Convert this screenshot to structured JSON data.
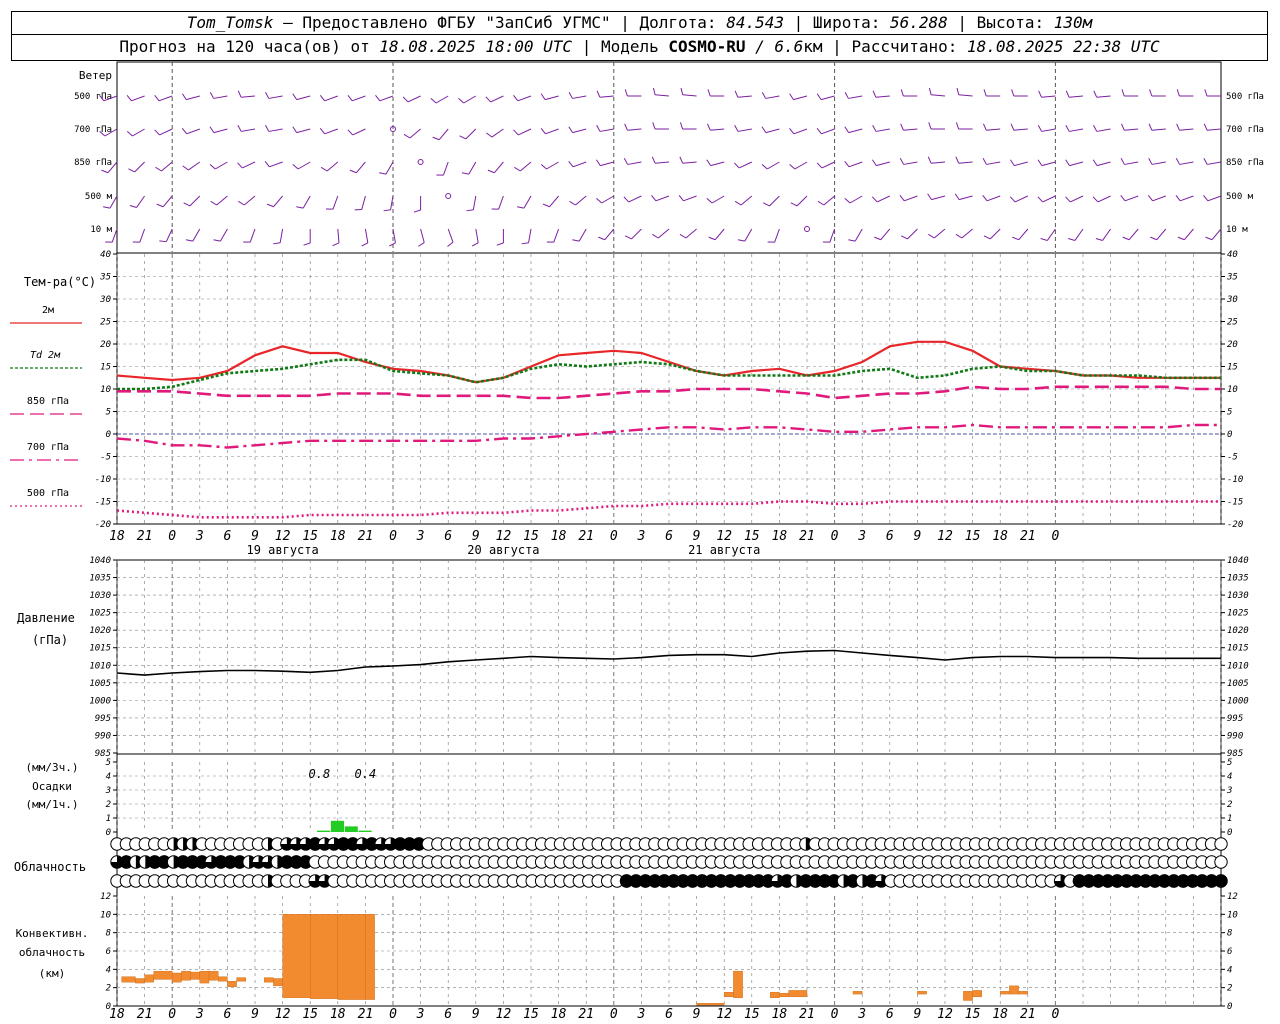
{
  "header": {
    "station": "Tom_Tomsk",
    "dash": " – ",
    "provider": "Предоставлено ФГБУ \"ЗапСиб УГМС\"",
    "sep": " | ",
    "lon_label": "Долгота: ",
    "lon_value": "84.543",
    "lat_label": "Широта: ",
    "lat_value": "56.288",
    "alt_label": "Высота: ",
    "alt_value": "130м",
    "forecast_prefix": "Прогноз на 120 часа(ов) от ",
    "forecast_start": "18.08.2025 18:00 UTC",
    "model_label": "Модель ",
    "model_name": "COSMO-RU",
    "model_res": " / 6.6",
    "model_unit": "км",
    "calc_label": "Рассчитано: ",
    "calc_time": "18.08.2025 22:38 UTC"
  },
  "labels": {
    "wind_title": "Ветер",
    "wind_levels": [
      "500 гПа",
      "700 гПа",
      "850 гПа",
      "500 м",
      "10  м"
    ],
    "temp_title": "Тем-ра(°C)",
    "temp_legend": [
      "2м",
      "Td  2м",
      "850 гПа",
      "700 гПа",
      "500 гПа"
    ],
    "pressure_title": [
      "Давление",
      "(гПа)"
    ],
    "precip_title": [
      "(мм/3ч.)",
      "Осадки",
      "(мм/1ч.)"
    ],
    "cloud_title": "Облачность",
    "conv_title": [
      "Конвективн.",
      "облачность",
      "(км)"
    ],
    "dates": [
      "19 августа",
      "20 августа",
      "21 августа"
    ],
    "hour_ticks": [
      "18",
      "21",
      "0",
      "3",
      "6",
      "9",
      "12",
      "15",
      "18",
      "21",
      "0",
      "3",
      "6",
      "9",
      "12",
      "15",
      "18",
      "21",
      "0",
      "3",
      "6",
      "9",
      "12",
      "15",
      "18",
      "21",
      "0",
      "3",
      "6",
      "9",
      "12",
      "15",
      "18",
      "21",
      "0"
    ]
  },
  "colors": {
    "wind": "#7b1fa2",
    "t2m": "#e8262a",
    "td2m": "#117a17",
    "t850": "#e0197d",
    "t700": "#e0197d",
    "t500": "#e0197d",
    "pressure": "#000000",
    "precip": "#22cc22",
    "convective": "#f28a30",
    "zero_line": "#2a2aa0"
  },
  "chart_data": {
    "type": "line",
    "x_unit": "hours since 18.08.2025 18:00 UTC",
    "x": [
      0,
      3,
      6,
      9,
      12,
      15,
      18,
      21,
      24,
      27,
      30,
      33,
      36,
      39,
      42,
      45,
      48,
      51,
      54,
      57,
      60,
      63,
      66,
      69,
      72,
      75,
      78,
      81,
      84,
      87,
      90,
      93,
      96,
      99,
      102,
      105,
      108,
      111,
      114,
      117,
      120
    ],
    "temperature": {
      "ylim": [
        -20,
        40
      ],
      "series": [
        {
          "name": "2м",
          "values": [
            13,
            12.5,
            12,
            12.5,
            14,
            17.5,
            19.5,
            18,
            18,
            16,
            14.5,
            14,
            13,
            11.5,
            12.5,
            15,
            17.5,
            18,
            18.5,
            18,
            16,
            14,
            13,
            14,
            14.5,
            13,
            14,
            16,
            19.5,
            20.5,
            20.5,
            18.5,
            15,
            14.5,
            14,
            13,
            13,
            12.5,
            12.5,
            12.5,
            12.5
          ]
        },
        {
          "name": "Td  2м",
          "values": [
            10,
            10,
            10.5,
            12,
            13.5,
            14,
            14.5,
            15.5,
            16.5,
            16.5,
            14,
            13.5,
            13,
            11.5,
            12.5,
            14.5,
            15.5,
            15,
            15.5,
            16,
            15.5,
            14,
            13,
            13,
            13,
            13,
            13,
            14,
            14.5,
            12.5,
            13,
            14.5,
            15,
            14,
            14,
            13,
            13,
            13,
            12.5,
            12.5,
            12.5
          ]
        },
        {
          "name": "850 гПа",
          "values": [
            9.5,
            9.5,
            9.5,
            9,
            8.5,
            8.5,
            8.5,
            8.5,
            9,
            9,
            9,
            8.5,
            8.5,
            8.5,
            8.5,
            8,
            8,
            8.5,
            9,
            9.5,
            9.5,
            10,
            10,
            10,
            9.5,
            9,
            8,
            8.5,
            9,
            9,
            9.5,
            10.5,
            10,
            10,
            10.5,
            10.5,
            10.5,
            10.5,
            10.5,
            10,
            10
          ]
        },
        {
          "name": "700 гПа",
          "values": [
            -1,
            -1.5,
            -2.5,
            -2.5,
            -3,
            -2.5,
            -2,
            -1.5,
            -1.5,
            -1.5,
            -1.5,
            -1.5,
            -1.5,
            -1.5,
            -1,
            -1,
            -0.5,
            0,
            0.5,
            1,
            1.5,
            1.5,
            1,
            1.5,
            1.5,
            1,
            0.5,
            0.5,
            1,
            1.5,
            1.5,
            2,
            1.5,
            1.5,
            1.5,
            1.5,
            1.5,
            1.5,
            1.5,
            2,
            2
          ]
        },
        {
          "name": "500 гПа",
          "values": [
            -17,
            -17.5,
            -18,
            -18.5,
            -18.5,
            -18.5,
            -18.5,
            -18,
            -18,
            -18,
            -18,
            -18,
            -17.5,
            -17.5,
            -17.5,
            -17,
            -17,
            -16.5,
            -16,
            -16,
            -15.5,
            -15.5,
            -15.5,
            -15.5,
            -15,
            -15,
            -15.5,
            -15.5,
            -15,
            -15,
            -15,
            -15,
            -15,
            -15,
            -15,
            -15,
            -15,
            -15,
            -15,
            -15,
            -15
          ]
        }
      ]
    },
    "pressure": {
      "ylim": [
        985,
        1040
      ],
      "name": "Давление",
      "values": [
        1007.8,
        1007.2,
        1007.8,
        1008.2,
        1008.5,
        1008.5,
        1008.3,
        1008,
        1008.5,
        1009.5,
        1009.8,
        1010.2,
        1011,
        1011.5,
        1012,
        1012.5,
        1012.2,
        1012,
        1011.8,
        1012.2,
        1012.8,
        1013,
        1013,
        1012.5,
        1013.5,
        1014,
        1014.2,
        1013.5,
        1012.8,
        1012.2,
        1011.5,
        1012.2,
        1012.5,
        1012.5,
        1012.2,
        1012.2,
        1012.2,
        1012,
        1012,
        1012,
        1012
      ]
    },
    "precipitation": {
      "ylim": [
        0,
        5
      ],
      "unit": "мм/3ч.",
      "bars": [
        {
          "x": 22.5,
          "value": 0.1
        },
        {
          "x": 24,
          "value": 0.8
        },
        {
          "x": 25.5,
          "value": 0.4
        },
        {
          "x": 27,
          "value": 0.1
        }
      ],
      "annotations": [
        {
          "x": 22,
          "text": "0.8"
        },
        {
          "x": 27,
          "text": "0.4"
        }
      ]
    },
    "convective_cloud": {
      "ylim": [
        0,
        12
      ],
      "unit": "км",
      "bars": [
        {
          "x0": 0.5,
          "x1": 2,
          "bottom": 2.6,
          "top": 3.2
        },
        {
          "x0": 2,
          "x1": 3,
          "bottom": 2.5,
          "top": 3.0
        },
        {
          "x0": 3,
          "x1": 4,
          "bottom": 2.6,
          "top": 3.4
        },
        {
          "x0": 4,
          "x1": 6,
          "bottom": 2.9,
          "top": 3.8
        },
        {
          "x0": 6,
          "x1": 7,
          "bottom": 2.6,
          "top": 3.6
        },
        {
          "x0": 7,
          "x1": 8,
          "bottom": 2.8,
          "top": 3.8
        },
        {
          "x0": 8,
          "x1": 9,
          "bottom": 2.9,
          "top": 3.7
        },
        {
          "x0": 9,
          "x1": 10,
          "bottom": 2.5,
          "top": 3.8
        },
        {
          "x0": 10,
          "x1": 11,
          "bottom": 2.8,
          "top": 3.8
        },
        {
          "x0": 11,
          "x1": 12,
          "bottom": 2.7,
          "top": 3.2
        },
        {
          "x0": 12,
          "x1": 13,
          "bottom": 2.1,
          "top": 2.7
        },
        {
          "x0": 13,
          "x1": 14,
          "bottom": 2.7,
          "top": 3.1
        },
        {
          "x0": 16,
          "x1": 17,
          "bottom": 2.6,
          "top": 3.1
        },
        {
          "x0": 17,
          "x1": 18,
          "bottom": 2.2,
          "top": 3.0
        },
        {
          "x0": 18,
          "x1": 21,
          "bottom": 0.9,
          "top": 10.0
        },
        {
          "x0": 21,
          "x1": 24,
          "bottom": 0.8,
          "top": 10.0
        },
        {
          "x0": 24,
          "x1": 27,
          "bottom": 0.7,
          "top": 10.0
        },
        {
          "x0": 27,
          "x1": 28,
          "bottom": 0.7,
          "top": 10.0
        },
        {
          "x0": 63,
          "x1": 66,
          "bottom": 0.1,
          "top": 0.3
        },
        {
          "x0": 66,
          "x1": 67,
          "bottom": 1.0,
          "top": 1.5
        },
        {
          "x0": 67,
          "x1": 68,
          "bottom": 0.9,
          "top": 3.8
        },
        {
          "x0": 71,
          "x1": 72,
          "bottom": 0.9,
          "top": 1.5
        },
        {
          "x0": 72,
          "x1": 73,
          "bottom": 1.0,
          "top": 1.4
        },
        {
          "x0": 73,
          "x1": 75,
          "bottom": 1.0,
          "top": 1.7
        },
        {
          "x0": 80,
          "x1": 81,
          "bottom": 1.3,
          "top": 1.6
        },
        {
          "x0": 87,
          "x1": 88,
          "bottom": 1.3,
          "top": 1.6
        },
        {
          "x0": 92,
          "x1": 93,
          "bottom": 0.6,
          "top": 1.6
        },
        {
          "x0": 93,
          "x1": 94,
          "bottom": 1.0,
          "top": 1.7
        },
        {
          "x0": 96,
          "x1": 97,
          "bottom": 1.3,
          "top": 1.6
        },
        {
          "x0": 97,
          "x1": 98,
          "bottom": 1.3,
          "top": 2.2
        },
        {
          "x0": 98,
          "x1": 99,
          "bottom": 1.3,
          "top": 1.6
        }
      ]
    },
    "cloud_cover": {
      "levels": [
        "upper",
        "middle",
        "lower"
      ],
      "x_step_hours": 1,
      "codes_legend": "0=clear,1=quarter,2=half,3=three-quarter,4=overcast",
      "upper": "0000002220000000203334334434334440000000000000000000000000000000000000000200000000000000000000000000000000000000000000",
      "middle": "3422442444344423324440000000000000000000000000000000000000000000000000000000000000000000000000000000000000000000000000",
      "lower": "0000000000000000200003300000000000000000000000000000004444444444444444342444424243000000000000000000304444444444444444"
    },
    "wind": {
      "levels": [
        "500 гПа",
        "700 гПа",
        "850 гПа",
        "500 м",
        "10  м"
      ],
      "x_step_hours": 3,
      "dir_deg": [
        [
          250,
          250,
          250,
          255,
          260,
          265,
          260,
          255,
          250,
          250,
          250,
          245,
          240,
          240,
          245,
          250,
          255,
          260,
          265,
          270,
          275,
          275,
          270,
          265,
          260,
          255,
          255,
          260,
          265,
          270,
          275,
          275,
          270,
          270,
          265,
          265,
          265,
          270,
          270,
          270,
          270
        ],
        [
          240,
          240,
          245,
          250,
          255,
          260,
          260,
          255,
          250,
          245,
          0,
          230,
          220,
          225,
          235,
          245,
          250,
          255,
          260,
          265,
          270,
          270,
          265,
          260,
          255,
          250,
          250,
          255,
          260,
          265,
          270,
          270,
          265,
          265,
          260,
          260,
          260,
          265,
          265,
          265,
          265
        ],
        [
          220,
          225,
          230,
          235,
          240,
          245,
          250,
          240,
          230,
          220,
          210,
          0,
          200,
          210,
          220,
          230,
          240,
          250,
          255,
          260,
          265,
          265,
          255,
          245,
          240,
          240,
          245,
          250,
          255,
          260,
          265,
          265,
          260,
          255,
          255,
          255,
          255,
          260,
          260,
          260,
          260
        ],
        [
          210,
          215,
          220,
          225,
          230,
          230,
          220,
          210,
          200,
          195,
          190,
          180,
          0,
          190,
          200,
          210,
          220,
          230,
          240,
          245,
          250,
          250,
          240,
          230,
          225,
          225,
          230,
          240,
          245,
          250,
          255,
          255,
          250,
          245,
          245,
          245,
          245,
          250,
          250,
          250,
          250
        ],
        [
          200,
          200,
          205,
          210,
          210,
          200,
          190,
          180,
          175,
          170,
          170,
          165,
          160,
          170,
          180,
          190,
          200,
          210,
          220,
          225,
          230,
          230,
          220,
          210,
          200,
          0,
          200,
          210,
          220,
          225,
          230,
          230,
          225,
          220,
          215,
          215,
          215,
          220,
          220,
          220,
          220
        ]
      ]
    }
  }
}
